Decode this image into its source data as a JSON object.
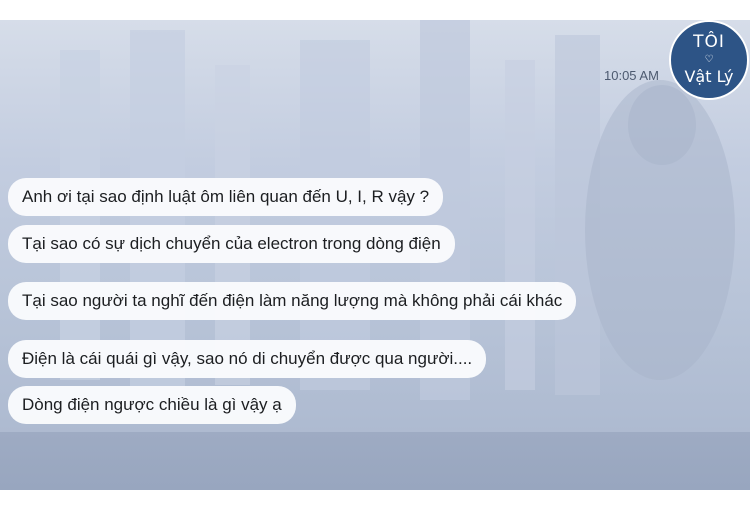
{
  "header": {
    "timestamp": "10:05 AM"
  },
  "logo": {
    "line1": "TÔI",
    "heart": "♡",
    "line2": "Vật Lý"
  },
  "messages": [
    {
      "text": "Anh ơi tại sao định luật ôm liên quan đến U, I, R vậy ?"
    },
    {
      "text": "Tại sao có sự dịch chuyển của electron trong dòng điện"
    },
    {
      "text": "Tại sao người ta nghĩ đến điện làm năng lượng mà không phải cái khác"
    },
    {
      "text": "Điện là cái quái gì vậy, sao nó di chuyển được qua người...."
    },
    {
      "text": "Dòng điện ngược chiều là gì vậy ạ"
    }
  ],
  "colors": {
    "bubble": "#fafbfd",
    "text": "#1c1e21",
    "logo_bg": "#2d5486",
    "background": "#b8c4d8"
  }
}
